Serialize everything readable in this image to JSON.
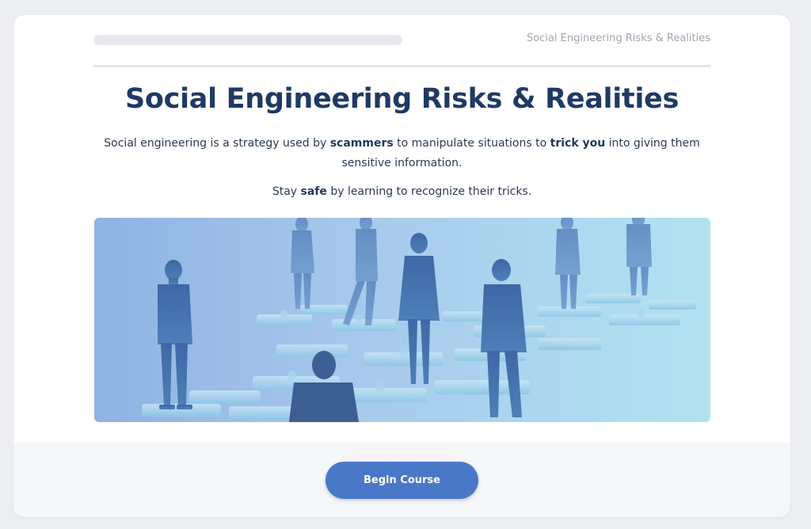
{
  "header": {
    "course_title": "Social Engineering Risks & Realities",
    "progress_percent": 0
  },
  "main": {
    "title": "Social Engineering Risks & Realities",
    "intro": {
      "part1": "Social engineering is a strategy used by ",
      "bold1": "scammers",
      "part2": " to manipulate situations to ",
      "bold2": "trick you",
      "part3": " into giving them sensitive information."
    },
    "tagline": {
      "part1": "Stay ",
      "bold1": "safe",
      "part2": " by learning to recognize their tricks."
    }
  },
  "footer": {
    "begin_label": "Begin Course"
  },
  "colors": {
    "accent": "#4a78c8",
    "title": "#1f3a64"
  }
}
